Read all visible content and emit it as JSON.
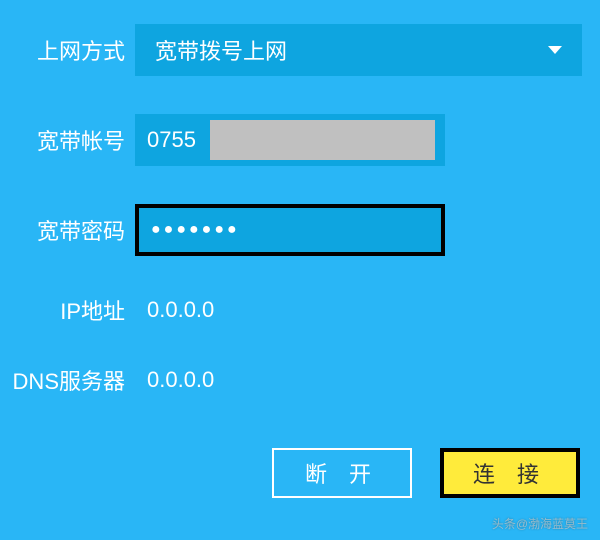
{
  "fields": {
    "connection_type": {
      "label": "上网方式",
      "value": "宽带拨号上网"
    },
    "account": {
      "label": "宽带帐号",
      "prefix": "0755"
    },
    "password": {
      "label": "宽带密码",
      "masked": "●●●●●●●"
    },
    "ip": {
      "label": "IP地址",
      "value": "0.0.0.0"
    },
    "dns": {
      "label": "DNS服务器",
      "value": "0.0.0.0"
    }
  },
  "buttons": {
    "disconnect": "断 开",
    "connect": "连 接"
  },
  "watermark": "头条@渤海蓝莫王"
}
